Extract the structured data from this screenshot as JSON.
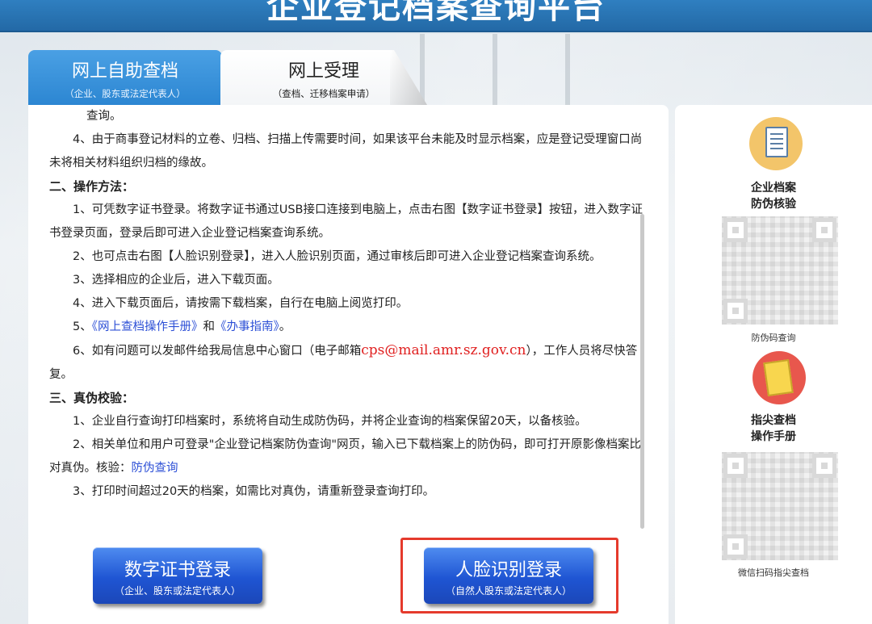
{
  "header": {
    "title": "企业登记档案查询平台"
  },
  "tabs": [
    {
      "label": "网上自助查档",
      "sub": "（企业、股东或法定代表人）"
    },
    {
      "label": "网上受理",
      "sub": "（查档、迁移档案申请）"
    }
  ],
  "content": {
    "line_cut": "查询。",
    "p4": "4、由于商事登记材料的立卷、归档、扫描上传需要时间，如果该平台未能及时显示档案，应是登记受理窗口尚未将相关材料组织归档的缘故。",
    "h2": "二、操作方法：",
    "s1": "1、可凭数字证书登录。将数字证书通过USB接口连接到电脑上，点击右图【数字证书登录】按钮，进入数字证书登录页面，登录后即可进入企业登记档案查询系统。",
    "s2": "2、也可点击右图【人脸识别登录】，进入人脸识别页面，通过审核后即可进入企业登记档案查询系统。",
    "s3": "3、选择相应的企业后，进入下载页面。",
    "s4": "4、进入下载页面后，请按需下载档案，自行在电脑上阅览打印。",
    "s5_prefix": "5、",
    "s5_link1": "《网上查档操作手册》",
    "s5_mid": "和",
    "s5_link2": "《办事指南》",
    "s5_suffix": "。",
    "s6_prefix": "6、如有问题可以发邮件给我局信息中心窗口（电子邮箱",
    "s6_email": "cps@mail.amr.sz.gov.cn",
    "s6_suffix": "），工作人员将尽快答复。",
    "h3": "三、真伪校验：",
    "v1": "1、企业自行查询打印档案时，系统将自动生成防伪码，并将企业查询的档案保留20天，以备核验。",
    "v2_text": "2、相关单位和用户可登录\"企业登记档案防伪查询\"网页，输入已下载档案上的防伪码，即可打开原影像档案比对真伪。核验：",
    "v2_link": "防伪查询",
    "v3": "3、打印时间超过20天的档案，如需比对真伪，请重新登录查询打印。"
  },
  "buttons": {
    "cert_label": "数字证书登录",
    "cert_sub": "（企业、股东或法定代表人）",
    "face_label": "人脸识别登录",
    "face_sub": "（自然人股东或法定代表人）"
  },
  "side": {
    "check_label_1": "企业档案",
    "check_label_2": "防伪核验",
    "check_caption": "防伪码查询",
    "manual_label_1": "指尖查档",
    "manual_label_2": "操作手册",
    "manual_caption": "微信扫码指尖查档",
    "icons": [
      "clipboard-check-icon",
      "notepad-pen-icon"
    ]
  },
  "colors": {
    "header_blue": "#2369a6",
    "tab_active": "#2c86d2",
    "button_blue": "#1f55d3",
    "link_blue": "#2c4fd6",
    "email_red": "#e02020",
    "highlight_red": "#e53a2c"
  }
}
